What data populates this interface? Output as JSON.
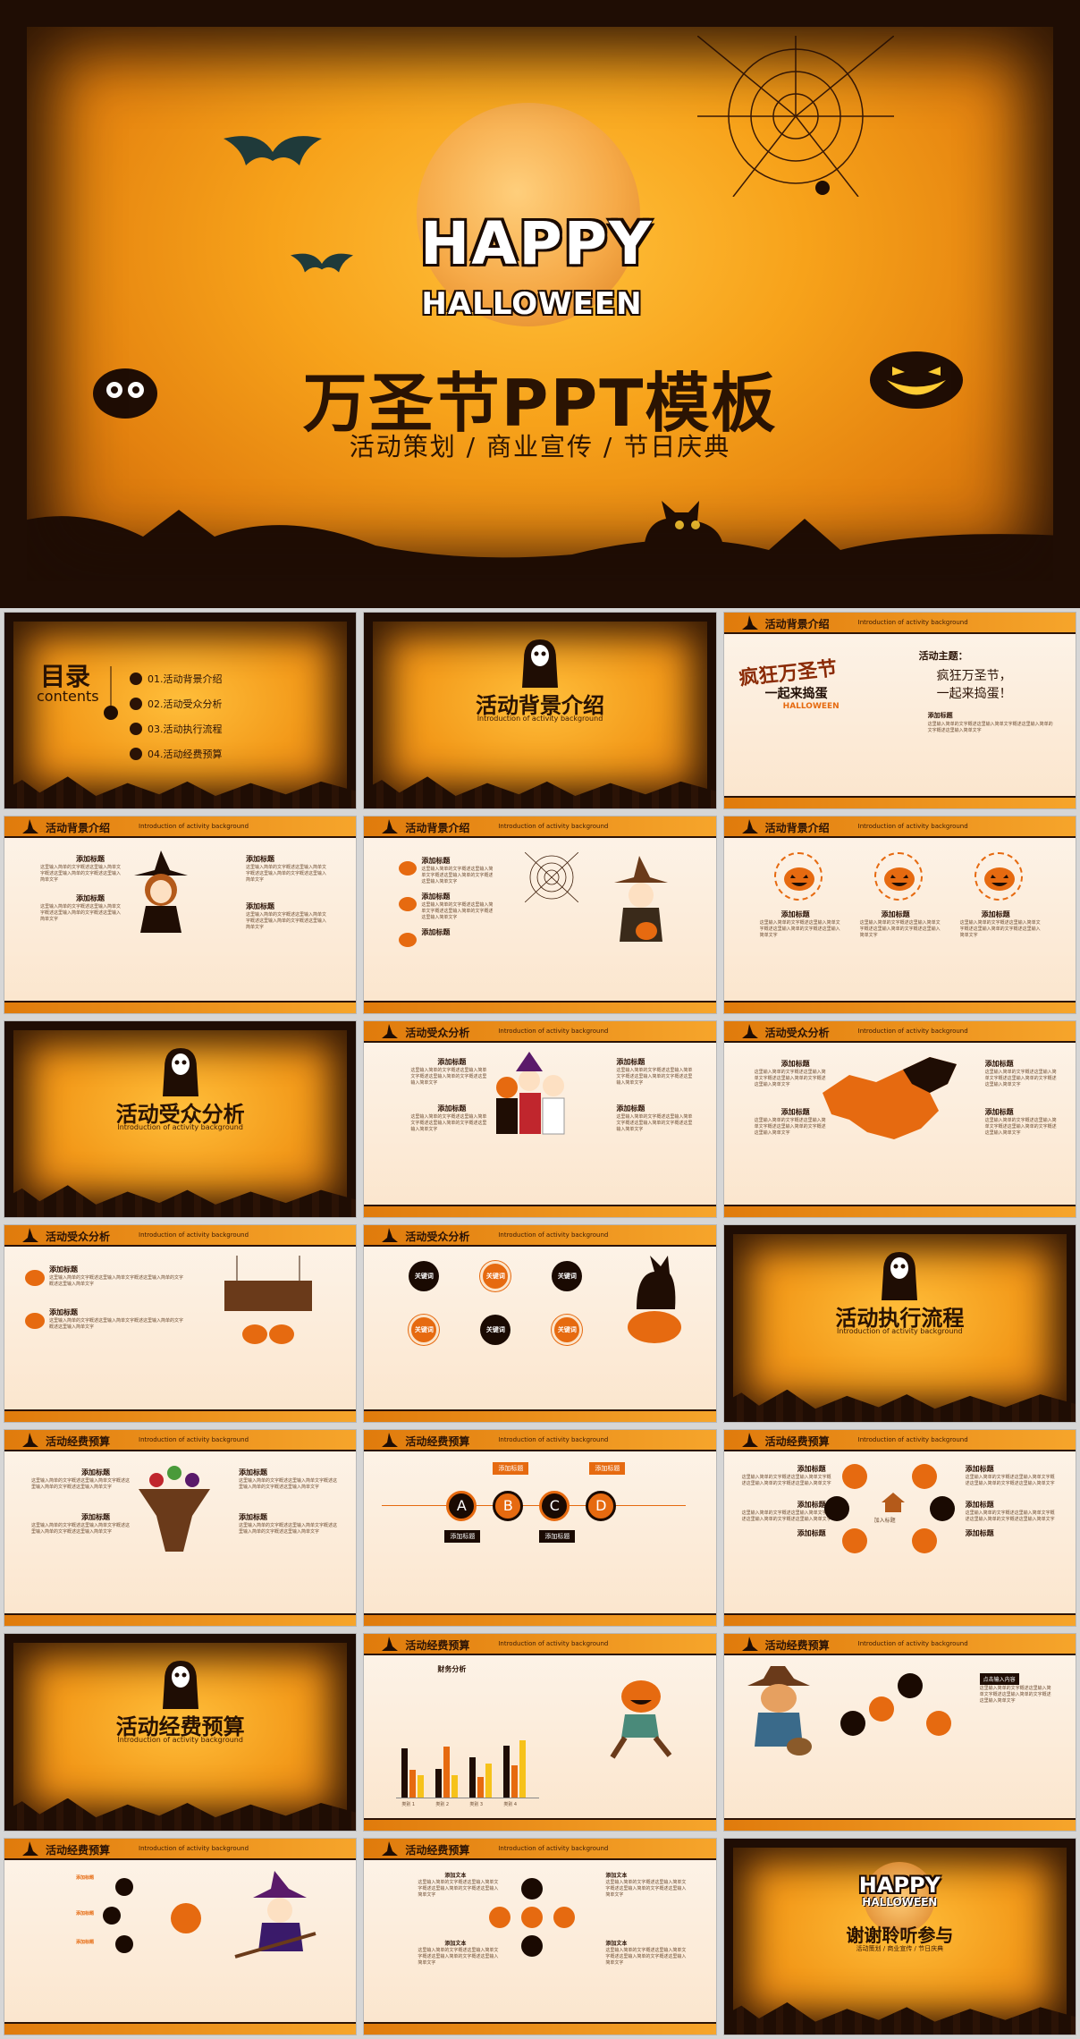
{
  "cover": {
    "happy": "HAPPY",
    "halloween": "HALLOWEEN",
    "title": "万圣节PPT模板",
    "subtitle": "活动策划 / 商业宣传 / 节日庆典"
  },
  "toc": {
    "title": "目录",
    "title_en": "contents",
    "items": [
      "01.活动背景介绍",
      "02.活动受众分析",
      "03.活动执行流程",
      "04.活动经费预算"
    ]
  },
  "sections": {
    "bg": "活动背景介绍",
    "audience": "活动受众分析",
    "flow": "活动执行流程",
    "budget": "活动经费预算",
    "sub_bg": "Introduction of activity background"
  },
  "header": {
    "bg": "活动背景介绍",
    "audience": "活动受众分析",
    "budget": "活动经费预算",
    "en": "Introduction of activity background"
  },
  "theme_slide": {
    "label": "活动主题：",
    "line1": "疯狂万圣节，",
    "line2": "一起来捣蛋！",
    "art1": "疯狂万圣节",
    "art2": "一起来捣蛋",
    "art3": "HALLOWEEN",
    "sub": "添加标题"
  },
  "common": {
    "add_title": "添加标题",
    "key": "关键词",
    "add_text": "添加文本",
    "click_input": "点击输入内容",
    "add_tag": "加入标题",
    "para": "这里输入简单的文字概述这里输入简单文字概述这里输入简单的文字概述这里输入简单文字"
  },
  "abcd": [
    "A",
    "B",
    "C",
    "D"
  ],
  "chart": {
    "title": "财务分析",
    "categories": [
      "类别 1",
      "类别 2",
      "类别 3",
      "类别 4"
    ]
  },
  "chart_data": {
    "type": "bar",
    "title": "财务分析",
    "categories": [
      "类别 1",
      "类别 2",
      "类别 3",
      "类别 4"
    ],
    "series": [
      {
        "values": [
          4.3,
          2.5,
          3.5,
          4.5
        ]
      },
      {
        "values": [
          2.4,
          4.4,
          1.8,
          2.8
        ]
      },
      {
        "values": [
          2,
          2,
          3,
          5
        ]
      }
    ],
    "ylim": [
      0,
      6
    ]
  },
  "ending": {
    "happy": "HAPPY",
    "halloween": "HALLOWEEN",
    "title": "谢谢聆听参与",
    "subtitle": "活动策划 / 商业宣传 / 节日庆典"
  },
  "colors": {
    "orange": "#f39a1a",
    "dark": "#1f0d04",
    "accent": "#e66a10"
  }
}
